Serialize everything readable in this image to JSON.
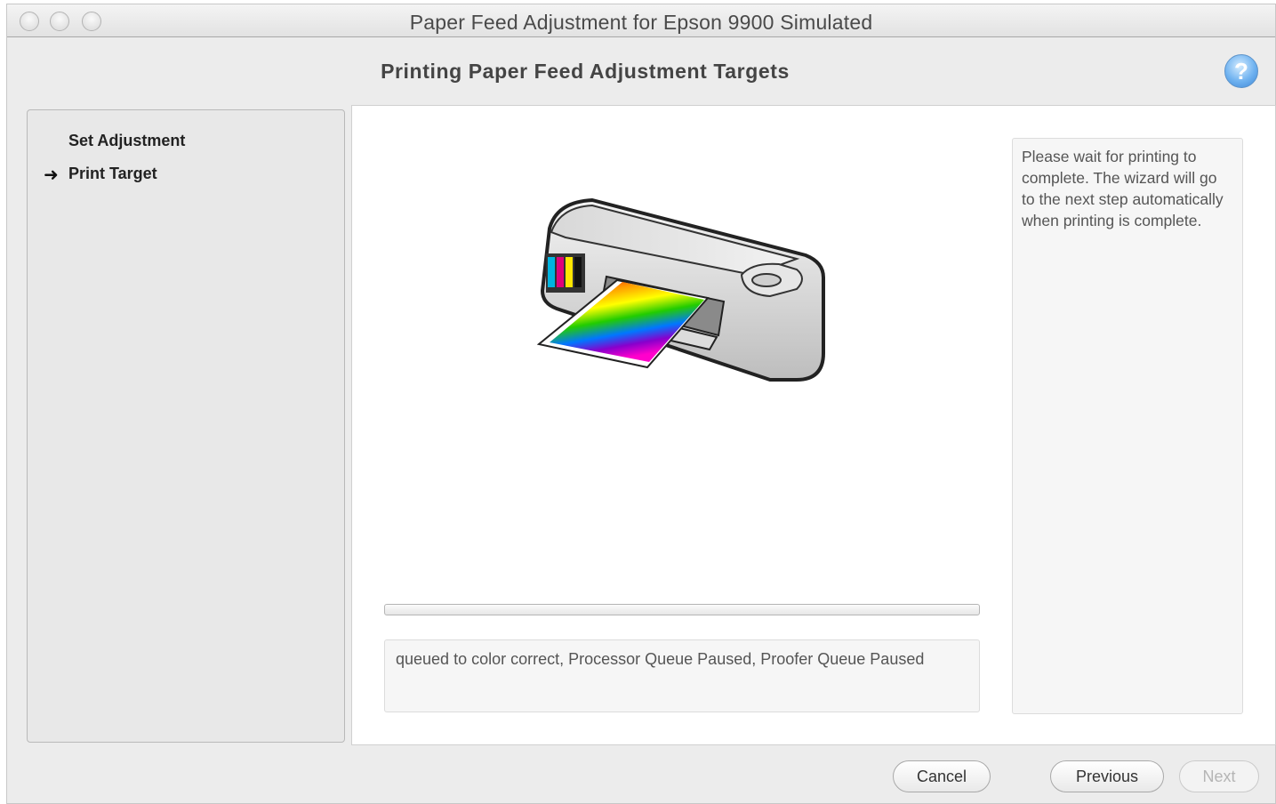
{
  "window": {
    "title": "Paper Feed Adjustment for Epson 9900 Simulated"
  },
  "header": {
    "title": "Printing Paper Feed Adjustment Targets",
    "help_icon": "help-icon",
    "help_label": "?"
  },
  "steps": [
    {
      "label": "Set Adjustment",
      "current": false
    },
    {
      "label": "Print Target",
      "current": true
    }
  ],
  "current_step_marker": "➜",
  "illustration": {
    "icon": "printer-icon",
    "colors": [
      "#ff0000",
      "#ff9900",
      "#ffff00",
      "#00cc00",
      "#0066ff",
      "#8800cc",
      "#ff00cc"
    ]
  },
  "progress": {
    "value": 0
  },
  "status": {
    "text": "queued to color correct, Processor Queue Paused, Proofer Queue Paused"
  },
  "info": {
    "text": "Please wait for printing to complete. The wizard will go to the next step automatically when printing is complete."
  },
  "buttons": {
    "cancel": "Cancel",
    "previous": "Previous",
    "next": "Next"
  }
}
